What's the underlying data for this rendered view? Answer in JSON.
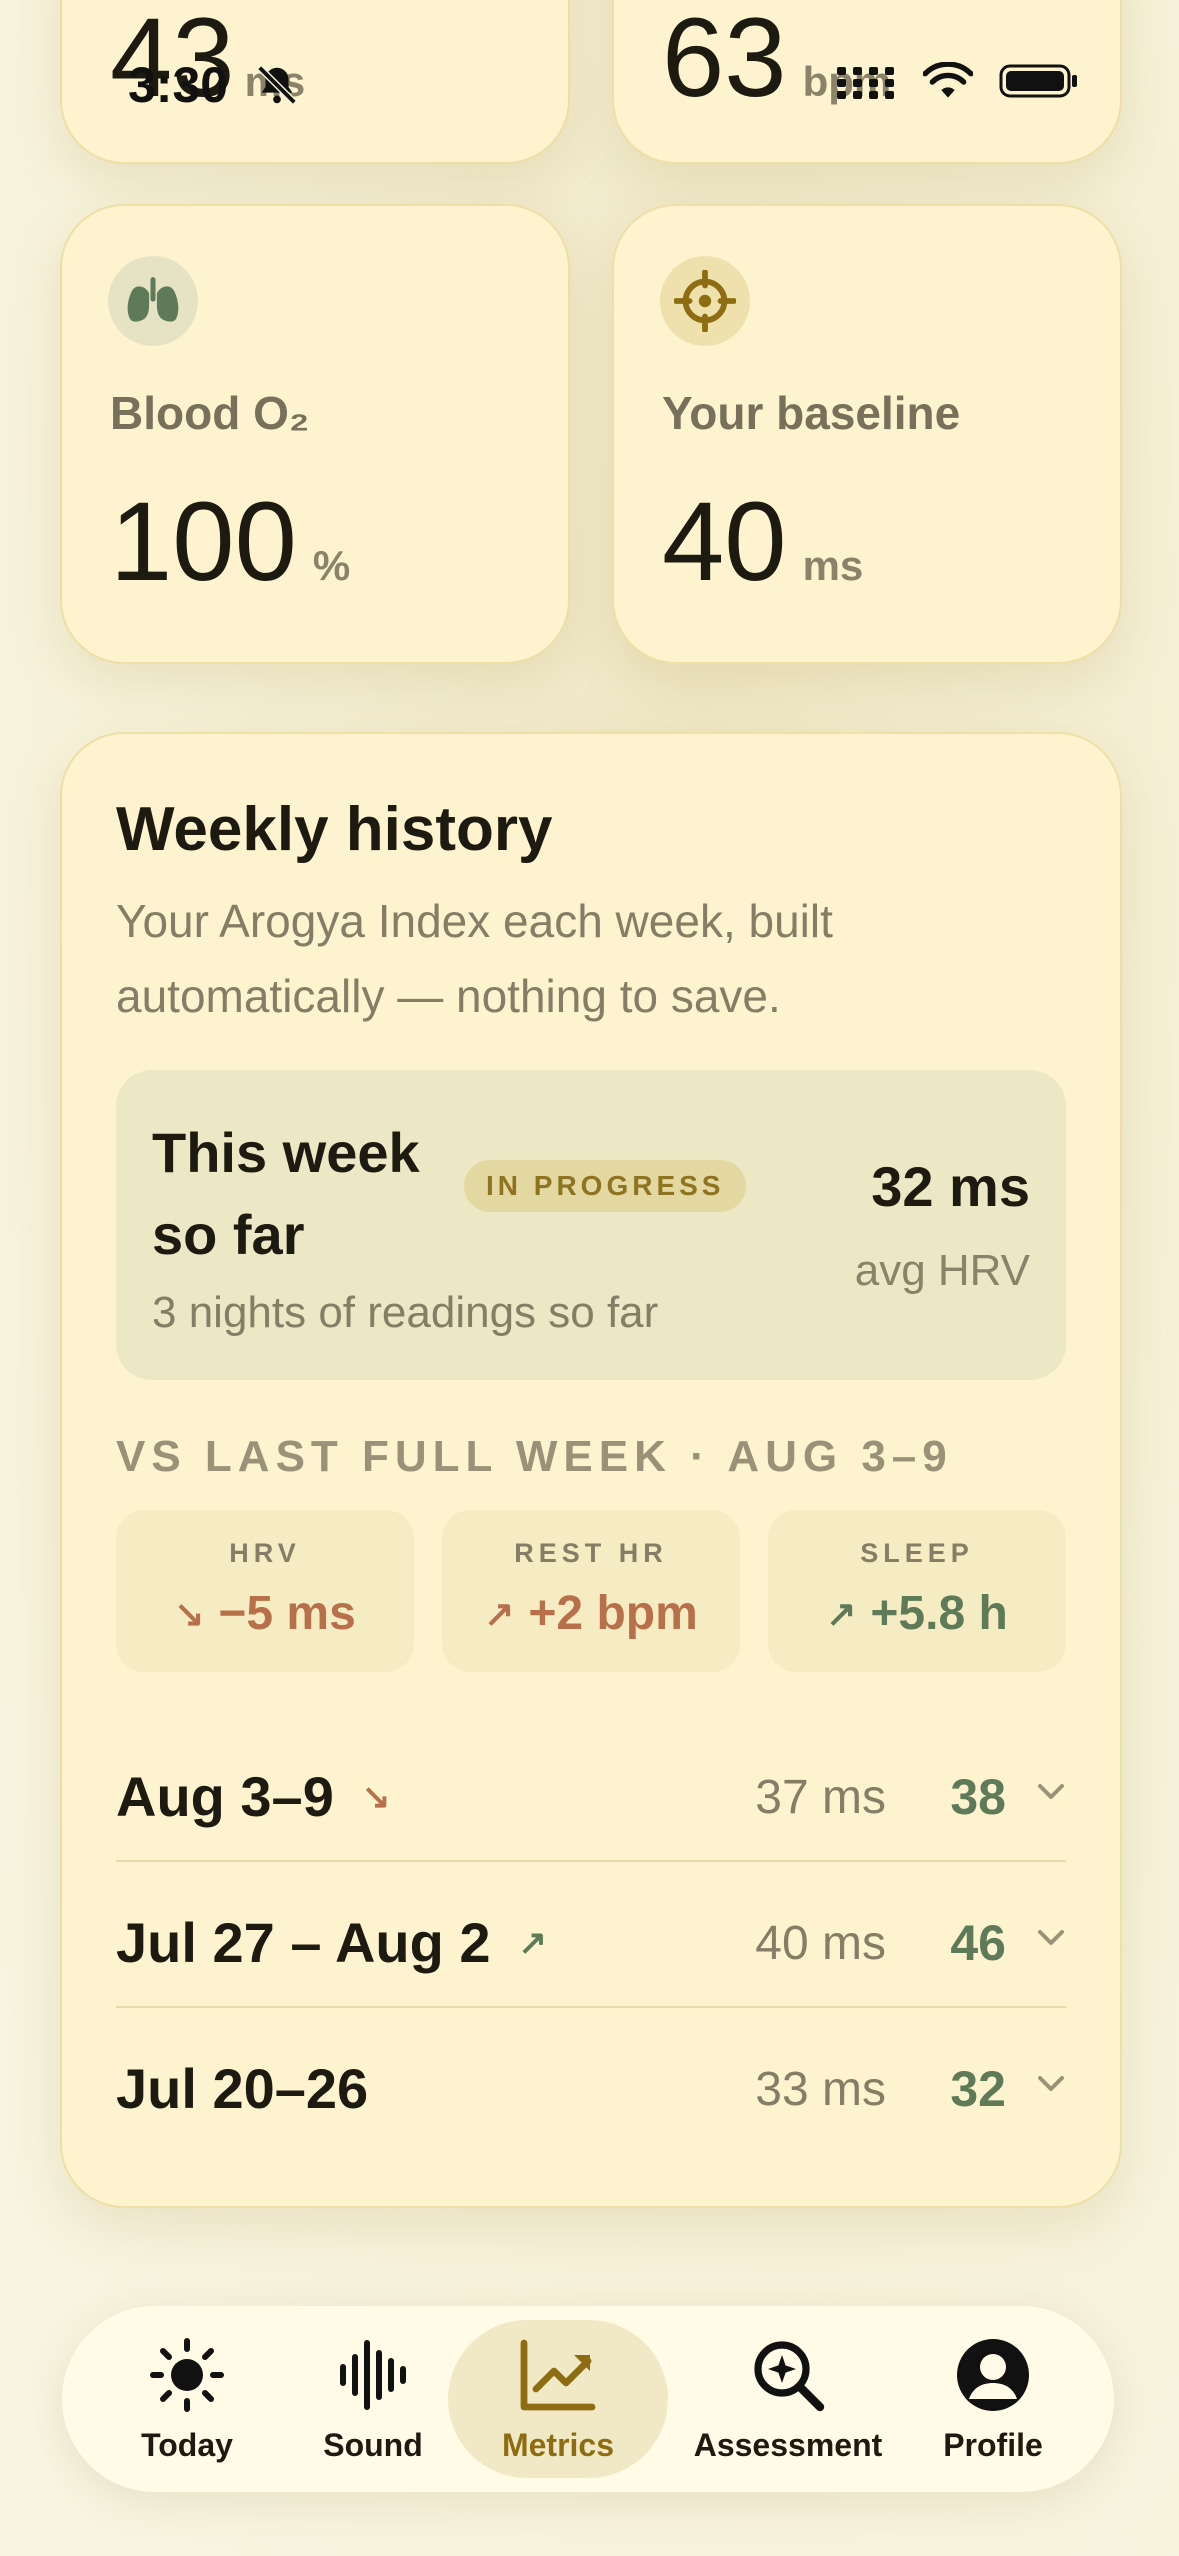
{
  "status_bar": {
    "time": "3:30"
  },
  "top_cards": [
    {
      "value": "43",
      "unit": "ms"
    },
    {
      "value": "63",
      "unit": "bpm"
    }
  ],
  "metrics": {
    "blood_o2": {
      "label": "Blood O₂",
      "value": "100",
      "unit": "%",
      "icon": "lungs-icon"
    },
    "baseline": {
      "label": "Your baseline",
      "value": "40",
      "unit": "ms",
      "icon": "target-icon"
    }
  },
  "weekly_history": {
    "title": "Weekly history",
    "subtitle": "Your Arogya Index each week, built automatically — nothing to save.",
    "this_week": {
      "title": "This week so far",
      "badge": "IN PROGRESS",
      "nights": "3 nights of readings so far",
      "hrv": "32 ms",
      "hrv_label": "avg HRV"
    },
    "vs_label": "VS LAST FULL WEEK · AUG 3–9",
    "deltas": [
      {
        "name": "HRV",
        "arrow": "↘",
        "value": "−5 ms",
        "color": "#b8704a"
      },
      {
        "name": "REST HR",
        "arrow": "↗",
        "value": "+2 bpm",
        "color": "#b8704a"
      },
      {
        "name": "SLEEP",
        "arrow": "↗",
        "value": "+5.8 h",
        "color": "#5f7a58"
      }
    ],
    "weeks": [
      {
        "date": "Aug 3–9",
        "trend": "↘",
        "trend_color": "#b8704a",
        "hrv": "37 ms",
        "score": "38"
      },
      {
        "date": "Jul 27 – Aug 2",
        "trend": "↗",
        "trend_color": "#5f7a58",
        "hrv": "40 ms",
        "score": "46"
      },
      {
        "date": "Jul 20–26",
        "trend": "",
        "trend_color": "#5f7a58",
        "hrv": "33 ms",
        "score": "32"
      }
    ]
  },
  "tabs": [
    {
      "label": "Today",
      "icon": "sun-icon",
      "active": false
    },
    {
      "label": "Sound",
      "icon": "waveform-icon",
      "active": false
    },
    {
      "label": "Metrics",
      "icon": "chart-icon",
      "active": true
    },
    {
      "label": "Assessment",
      "icon": "magnifier-icon",
      "active": false
    },
    {
      "label": "Profile",
      "icon": "person-icon",
      "active": false
    }
  ],
  "colors": {
    "accent": "#8e6d12",
    "card": "#fdf4cf",
    "good": "#5f7a58",
    "bad": "#b8704a"
  }
}
